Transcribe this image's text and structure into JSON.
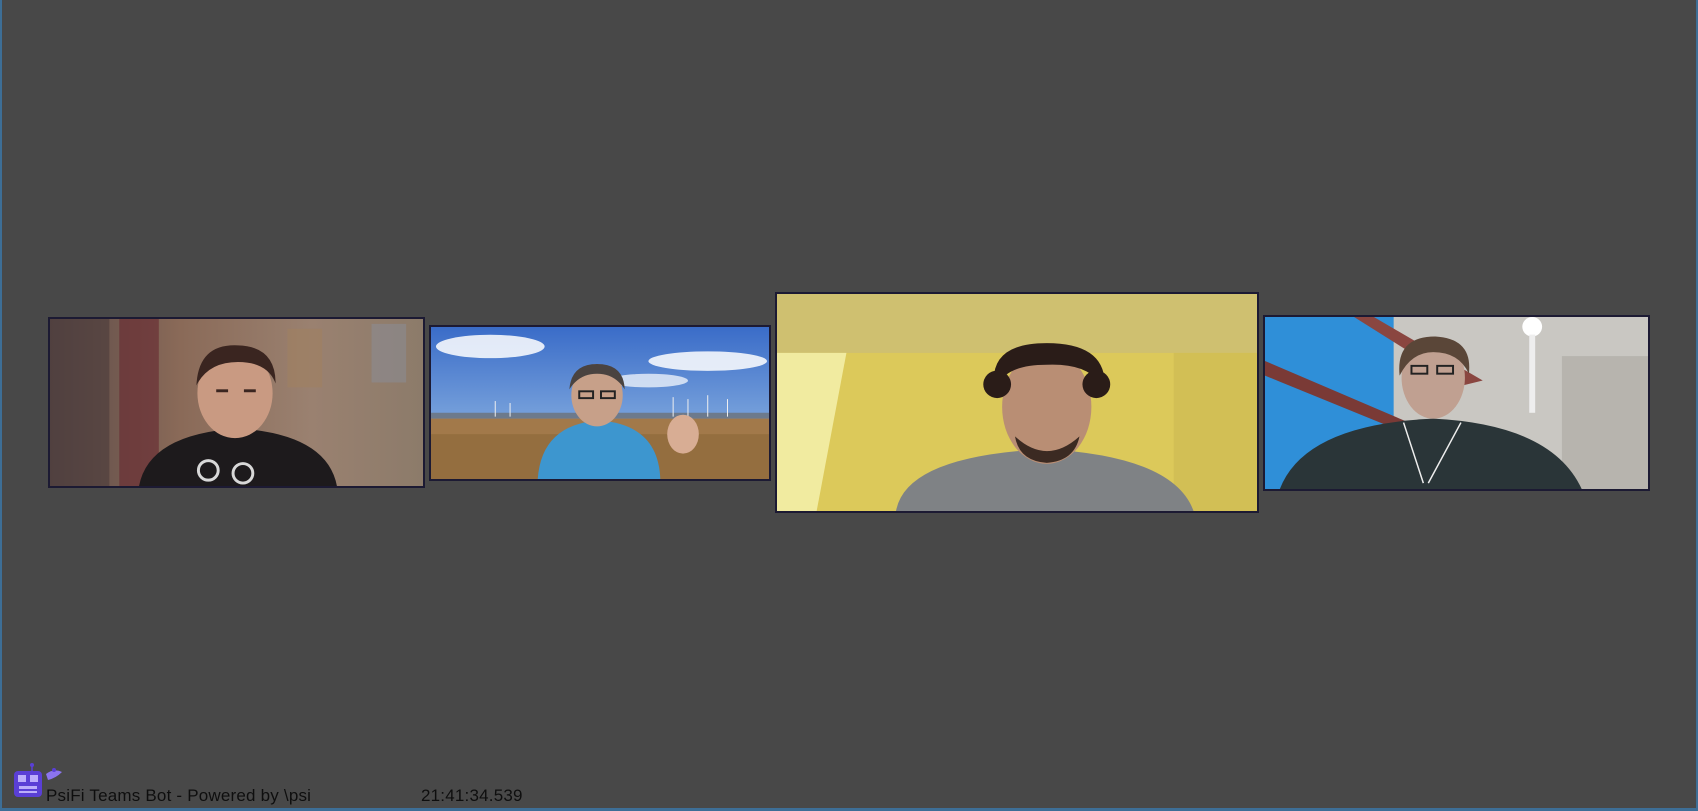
{
  "app": {
    "footer_title": "PsiFi Teams Bot - Powered by \\psi",
    "timestamp": "21:41:34.539",
    "logo_icon": "robot-logo-icon"
  },
  "participants": [
    {
      "tile": 1,
      "video": "participant-video"
    },
    {
      "tile": 2,
      "video": "participant-video"
    },
    {
      "tile": 3,
      "video": "participant-video"
    },
    {
      "tile": 4,
      "video": "participant-video"
    }
  ],
  "colors": {
    "background": "#484848",
    "window_border": "#3d6e96",
    "tile_border": "#1c1a33",
    "footer_text": "#0e0e0e",
    "logo": "#5a3fd6"
  }
}
